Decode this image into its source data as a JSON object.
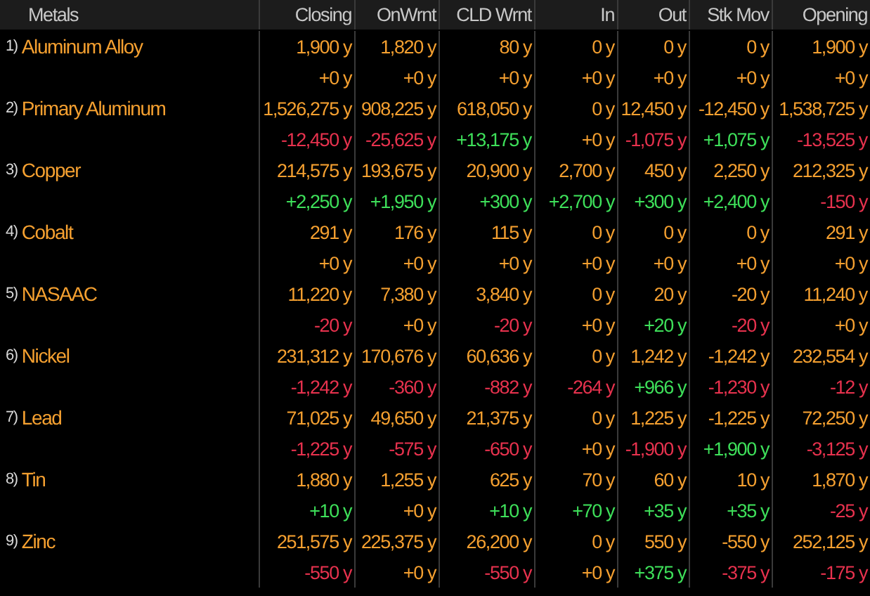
{
  "columns": [
    "Metals",
    "Closing",
    "OnWrnt",
    "CLD Wrnt",
    "In",
    "Out",
    "Stk Mov",
    "Opening"
  ],
  "rows": [
    {
      "index": "1)",
      "name": "Aluminum Alloy",
      "values": [
        "1,900 y",
        "1,820 y",
        "80 y",
        "0 y",
        "0 y",
        "0 y",
        "1,900 y"
      ],
      "changes": [
        {
          "text": "+0 y",
          "color": "#f5a030"
        },
        {
          "text": "+0 y",
          "color": "#f5a030"
        },
        {
          "text": "+0 y",
          "color": "#f5a030"
        },
        {
          "text": "+0 y",
          "color": "#f5a030"
        },
        {
          "text": "+0 y",
          "color": "#f5a030"
        },
        {
          "text": "+0 y",
          "color": "#f5a030"
        },
        {
          "text": "+0 y",
          "color": "#f5a030"
        }
      ]
    },
    {
      "index": "2)",
      "name": "Primary Aluminum",
      "values": [
        "1,526,275 y",
        "908,225 y",
        "618,050 y",
        "0 y",
        "12,450 y",
        "-12,450 y",
        "1,538,725 y"
      ],
      "changes": [
        {
          "text": "-12,450 y",
          "color": "#e8324e"
        },
        {
          "text": "-25,625 y",
          "color": "#e8324e"
        },
        {
          "text": "+13,175 y",
          "color": "#3ee05a"
        },
        {
          "text": "+0 y",
          "color": "#f5a030"
        },
        {
          "text": "-1,075 y",
          "color": "#e8324e"
        },
        {
          "text": "+1,075 y",
          "color": "#3ee05a"
        },
        {
          "text": "-13,525 y",
          "color": "#e8324e"
        }
      ]
    },
    {
      "index": "3)",
      "name": "Copper",
      "values": [
        "214,575 y",
        "193,675 y",
        "20,900 y",
        "2,700 y",
        "450 y",
        "2,250 y",
        "212,325 y"
      ],
      "changes": [
        {
          "text": "+2,250 y",
          "color": "#3ee05a"
        },
        {
          "text": "+1,950 y",
          "color": "#3ee05a"
        },
        {
          "text": "+300 y",
          "color": "#3ee05a"
        },
        {
          "text": "+2,700 y",
          "color": "#3ee05a"
        },
        {
          "text": "+300 y",
          "color": "#3ee05a"
        },
        {
          "text": "+2,400 y",
          "color": "#3ee05a"
        },
        {
          "text": "-150 y",
          "color": "#e8324e"
        }
      ]
    },
    {
      "index": "4)",
      "name": "Cobalt",
      "values": [
        "291 y",
        "176 y",
        "115 y",
        "0 y",
        "0 y",
        "0 y",
        "291 y"
      ],
      "changes": [
        {
          "text": "+0 y",
          "color": "#f5a030"
        },
        {
          "text": "+0 y",
          "color": "#f5a030"
        },
        {
          "text": "+0 y",
          "color": "#f5a030"
        },
        {
          "text": "+0 y",
          "color": "#f5a030"
        },
        {
          "text": "+0 y",
          "color": "#f5a030"
        },
        {
          "text": "+0 y",
          "color": "#f5a030"
        },
        {
          "text": "+0 y",
          "color": "#f5a030"
        }
      ]
    },
    {
      "index": "5)",
      "name": "NASAAC",
      "values": [
        "11,220 y",
        "7,380 y",
        "3,840 y",
        "0 y",
        "20 y",
        "-20 y",
        "11,240 y"
      ],
      "changes": [
        {
          "text": "-20 y",
          "color": "#e8324e"
        },
        {
          "text": "+0 y",
          "color": "#f5a030"
        },
        {
          "text": "-20 y",
          "color": "#e8324e"
        },
        {
          "text": "+0 y",
          "color": "#f5a030"
        },
        {
          "text": "+20 y",
          "color": "#3ee05a"
        },
        {
          "text": "-20 y",
          "color": "#e8324e"
        },
        {
          "text": "+0 y",
          "color": "#f5a030"
        }
      ]
    },
    {
      "index": "6)",
      "name": "Nickel",
      "values": [
        "231,312 y",
        "170,676 y",
        "60,636 y",
        "0 y",
        "1,242 y",
        "-1,242 y",
        "232,554 y"
      ],
      "changes": [
        {
          "text": "-1,242 y",
          "color": "#e8324e"
        },
        {
          "text": "-360 y",
          "color": "#e8324e"
        },
        {
          "text": "-882 y",
          "color": "#e8324e"
        },
        {
          "text": "-264 y",
          "color": "#e8324e"
        },
        {
          "text": "+966 y",
          "color": "#3ee05a"
        },
        {
          "text": "-1,230 y",
          "color": "#e8324e"
        },
        {
          "text": "-12 y",
          "color": "#e8324e"
        }
      ]
    },
    {
      "index": "7)",
      "name": "Lead",
      "values": [
        "71,025 y",
        "49,650 y",
        "21,375 y",
        "0 y",
        "1,225 y",
        "-1,225 y",
        "72,250 y"
      ],
      "changes": [
        {
          "text": "-1,225 y",
          "color": "#e8324e"
        },
        {
          "text": "-575 y",
          "color": "#e8324e"
        },
        {
          "text": "-650 y",
          "color": "#e8324e"
        },
        {
          "text": "+0 y",
          "color": "#f5a030"
        },
        {
          "text": "-1,900 y",
          "color": "#e8324e"
        },
        {
          "text": "+1,900 y",
          "color": "#3ee05a"
        },
        {
          "text": "-3,125 y",
          "color": "#e8324e"
        }
      ]
    },
    {
      "index": "8)",
      "name": "Tin",
      "values": [
        "1,880 y",
        "1,255 y",
        "625 y",
        "70 y",
        "60 y",
        "10 y",
        "1,870 y"
      ],
      "changes": [
        {
          "text": "+10 y",
          "color": "#3ee05a"
        },
        {
          "text": "+0 y",
          "color": "#f5a030"
        },
        {
          "text": "+10 y",
          "color": "#3ee05a"
        },
        {
          "text": "+70 y",
          "color": "#3ee05a"
        },
        {
          "text": "+35 y",
          "color": "#3ee05a"
        },
        {
          "text": "+35 y",
          "color": "#3ee05a"
        },
        {
          "text": "-25 y",
          "color": "#e8324e"
        }
      ]
    },
    {
      "index": "9)",
      "name": "Zinc",
      "values": [
        "251,575 y",
        "225,375 y",
        "26,200 y",
        "0 y",
        "550 y",
        "-550 y",
        "252,125 y"
      ],
      "changes": [
        {
          "text": "-550 y",
          "color": "#e8324e"
        },
        {
          "text": "+0 y",
          "color": "#f5a030"
        },
        {
          "text": "-550 y",
          "color": "#e8324e"
        },
        {
          "text": "+0 y",
          "color": "#f5a030"
        },
        {
          "text": "+375 y",
          "color": "#3ee05a"
        },
        {
          "text": "-375 y",
          "color": "#e8324e"
        },
        {
          "text": "-175 y",
          "color": "#e8324e"
        }
      ]
    }
  ]
}
